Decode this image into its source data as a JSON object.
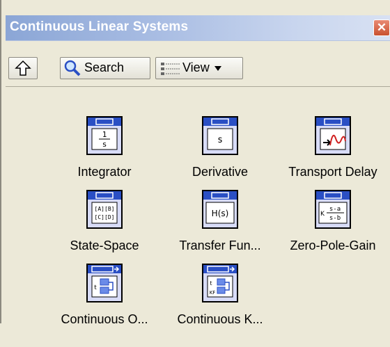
{
  "window": {
    "title": "Continuous Linear Systems",
    "close_glyph": "✕"
  },
  "toolbar": {
    "up_icon": "up-arrow-icon",
    "search_label": "Search",
    "search_icon": "magnifier-icon",
    "view_label": "View",
    "view_icon": "view-list-icon",
    "view_dropdown_icon": "triangle-down-icon"
  },
  "palette": {
    "items": [
      {
        "label": "Integrator",
        "icon": "integrator-icon",
        "glyph_line1": "1",
        "glyph_line2": "s"
      },
      {
        "label": "Derivative",
        "icon": "derivative-icon",
        "glyph_line1": "s"
      },
      {
        "label": "Transport Delay",
        "icon": "transport-delay-icon"
      },
      {
        "label": "State-Space",
        "icon": "state-space-icon",
        "glyph_line1": "[A][B]",
        "glyph_line2": "[C][D]"
      },
      {
        "label": "Transfer Fun...",
        "icon": "transfer-function-icon",
        "glyph_line1": "H(s)"
      },
      {
        "label": "Zero-Pole-Gain",
        "icon": "zero-pole-gain-icon",
        "glyph_line1": "s-a",
        "glyph_line2": "s-b",
        "glyph_prefix": "K"
      },
      {
        "label": "Continuous O...",
        "icon": "continuous-observer-icon",
        "glyph_line1": "t"
      },
      {
        "label": "Continuous K...",
        "icon": "continuous-kalman-icon",
        "glyph_line1": "t",
        "glyph_line2": "KF"
      }
    ]
  },
  "colors": {
    "icon_header": "#2a4fc4",
    "icon_bg": "#d8dcf8",
    "title_gradient_start": "#8ba6d6"
  }
}
